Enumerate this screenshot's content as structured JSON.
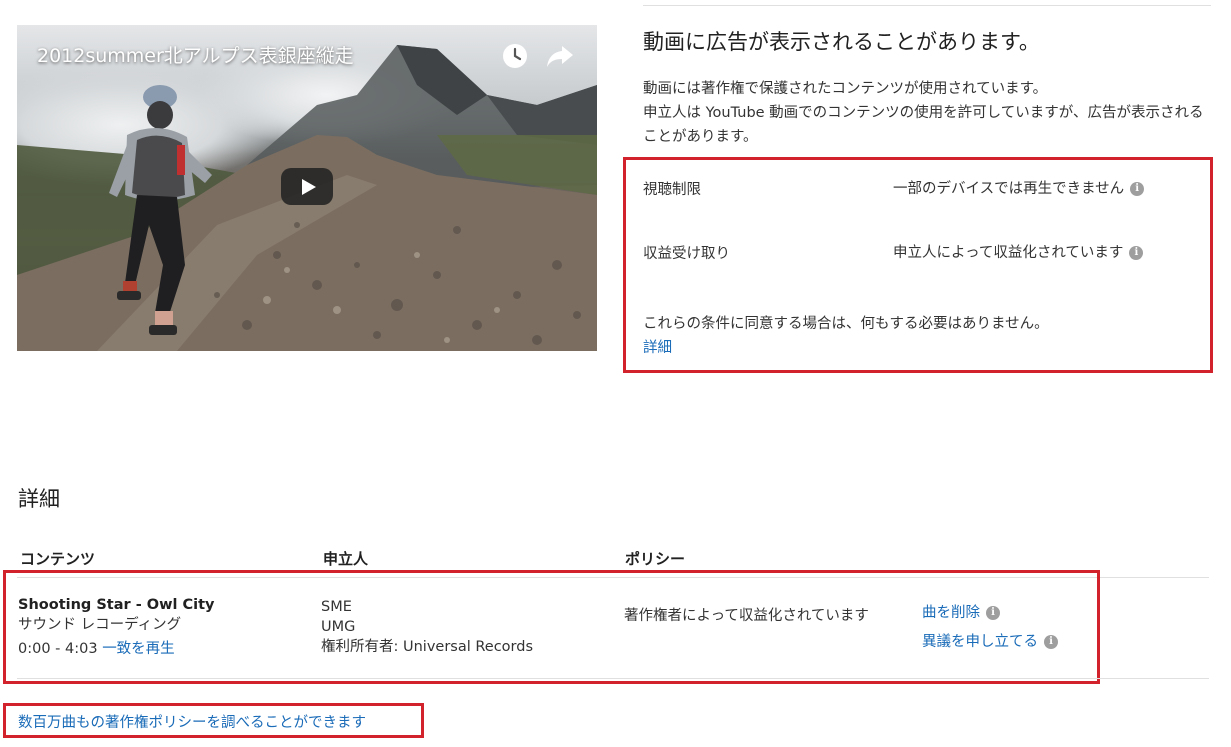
{
  "video": {
    "title": "2012summer北アルプス表銀座縦走",
    "icons": {
      "watch_later": "clock-icon",
      "share": "share-arrow-icon",
      "play": "play-icon"
    }
  },
  "notice": {
    "title": "動画に広告が表示されることがあります。",
    "line1": "動画には著作権で保護されたコンテンツが使用されています。",
    "line2": "申立人は YouTube 動画でのコンテンツの使用を許可していますが、広告が表示されることがあります。"
  },
  "conditions": [
    {
      "label": "視聴制限",
      "value": "一部のデバイスでは再生できません"
    },
    {
      "label": "収益受け取り",
      "value": "申立人によって収益化されています"
    }
  ],
  "agreement": {
    "text": "これらの条件に同意する場合は、何もする必要はありません。",
    "link": "詳細"
  },
  "details": {
    "title": "詳細",
    "columns": [
      "コンテンツ",
      "申立人",
      "ポリシー"
    ],
    "row": {
      "song_title": "Shooting Star - Owl City",
      "content_type": "サウンド レコーディング",
      "time_range": "0:00 - 4:03",
      "play_match": "一致を再生",
      "claimants": [
        "SME",
        "UMG",
        "権利所有者: Universal Records"
      ],
      "policy": "著作権者によって収益化されています",
      "actions": [
        "曲を削除",
        "異議を申し立てる"
      ]
    }
  },
  "footer_link": "数百万曲もの著作権ポリシーを調べることができます",
  "colors": {
    "link": "#1a6bb8",
    "highlight": "#d2232d",
    "info_icon": "#9e9e9e"
  }
}
